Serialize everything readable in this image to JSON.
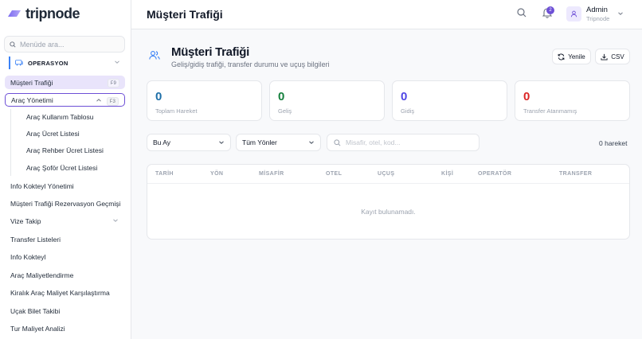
{
  "brand": {
    "name": "tripnode"
  },
  "sidebar": {
    "search_placeholder": "Menüde ara...",
    "section": "OPERASYON",
    "items": [
      {
        "label": "Müşteri Trafiği",
        "shortcut": "F9"
      },
      {
        "label": "Araç Yönetimi",
        "shortcut": "F3"
      }
    ],
    "subitems": [
      "Araç Kullanım Tablosu",
      "Araç Ücret Listesi",
      "Araç Rehber Ücret Listesi",
      "Araç Şoför Ücret Listesi"
    ],
    "more": [
      "Info Kokteyl Yönetimi",
      "Müşteri Trafiği Rezervasyon Geçmişi",
      "Vize Takip",
      "Transfer Listeleri",
      "Info Kokteyl",
      "Araç Maliyetlendirme",
      "Kiralık Araç Maliyet Karşılaştırma",
      "Uçak Bilet Takibi",
      "Tur Maliyet Analizi"
    ]
  },
  "topbar": {
    "title": "Müşteri Trafiği",
    "notifications": "2",
    "user_name": "Admin",
    "user_org": "Tripnode"
  },
  "page": {
    "title": "Müşteri Trafiği",
    "subtitle": "Geliş/gidiş trafiği, transfer durumu ve uçuş bilgileri",
    "refresh_label": "Yenile",
    "csv_label": "CSV"
  },
  "stats": [
    {
      "value": "0",
      "label": "Toplam Hareket",
      "color": "#1e6fa8"
    },
    {
      "value": "0",
      "label": "Geliş",
      "color": "#15803d"
    },
    {
      "value": "0",
      "label": "Gidiş",
      "color": "#4f46e5"
    },
    {
      "value": "0",
      "label": "Transfer Atanmamış",
      "color": "#dc2626"
    }
  ],
  "filters": {
    "period": "Bu Ay",
    "direction": "Tüm Yönler",
    "search_placeholder": "Misafir, otel, kod...",
    "count": "0 hareket"
  },
  "table": {
    "columns": [
      "TARİH",
      "YÖN",
      "MİSAFİR",
      "OTEL",
      "UÇUŞ",
      "KİŞİ",
      "OPERATÖR",
      "TRANSFER"
    ],
    "empty": "Kayıt bulunamadı."
  }
}
